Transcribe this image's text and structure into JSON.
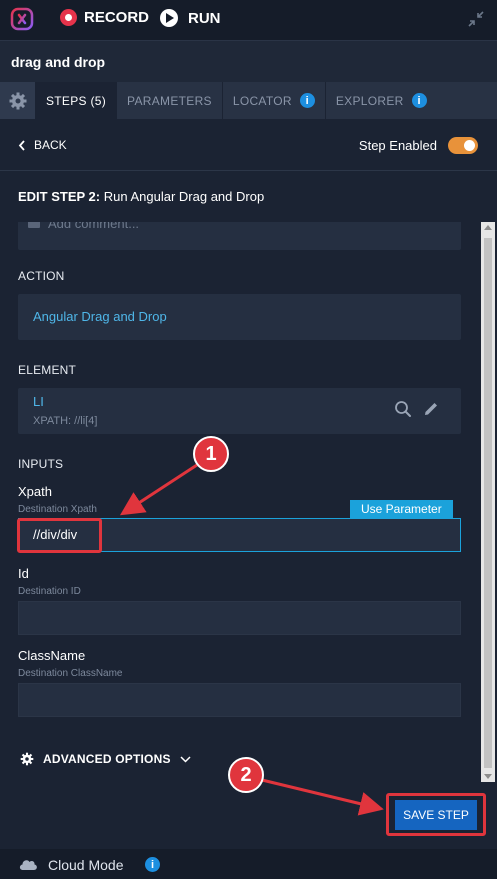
{
  "topbar": {
    "record_label": "RECORD",
    "run_label": "RUN"
  },
  "test": {
    "name": "drag and drop"
  },
  "tabs": [
    {
      "label": "STEPS (5)",
      "active": true
    },
    {
      "label": "PARAMETERS",
      "active": false
    },
    {
      "label": "LOCATOR",
      "active": false,
      "info": "i"
    },
    {
      "label": "EXPLORER",
      "active": false,
      "info": "i"
    }
  ],
  "step_header": {
    "back_label": "BACK",
    "step_enabled_label": "Step Enabled",
    "step_enabled": true
  },
  "edit": {
    "prefix": "EDIT STEP 2:",
    "title": "Run Angular Drag and Drop"
  },
  "comment": {
    "placeholder": "Add comment..."
  },
  "action": {
    "label": "ACTION",
    "value": "Angular Drag and Drop"
  },
  "element": {
    "label": "ELEMENT",
    "name": "LI",
    "xpath": "XPATH: //li[4]"
  },
  "inputs": {
    "label": "INPUTS",
    "use_parameter_label": "Use Parameter",
    "fields": [
      {
        "label": "Xpath",
        "sub": "Destination Xpath",
        "value": "//div/div"
      },
      {
        "label": "Id",
        "sub": "Destination ID",
        "value": ""
      },
      {
        "label": "ClassName",
        "sub": "Destination ClassName",
        "value": ""
      }
    ]
  },
  "advanced": {
    "label": "ADVANCED OPTIONS"
  },
  "save": {
    "label": "SAVE STEP"
  },
  "footer": {
    "cloud_label": "Cloud Mode",
    "info": "i"
  },
  "annotations": {
    "badge1": "1",
    "badge2": "2"
  },
  "colors": {
    "background": "#1b2333",
    "accent_orange": "#e8923a",
    "accent_blue": "#1ba2db",
    "link_blue": "#4fb6e8",
    "record_red": "#e5334b",
    "annotation_red": "#e0353d",
    "save_blue": "#1565c0"
  }
}
